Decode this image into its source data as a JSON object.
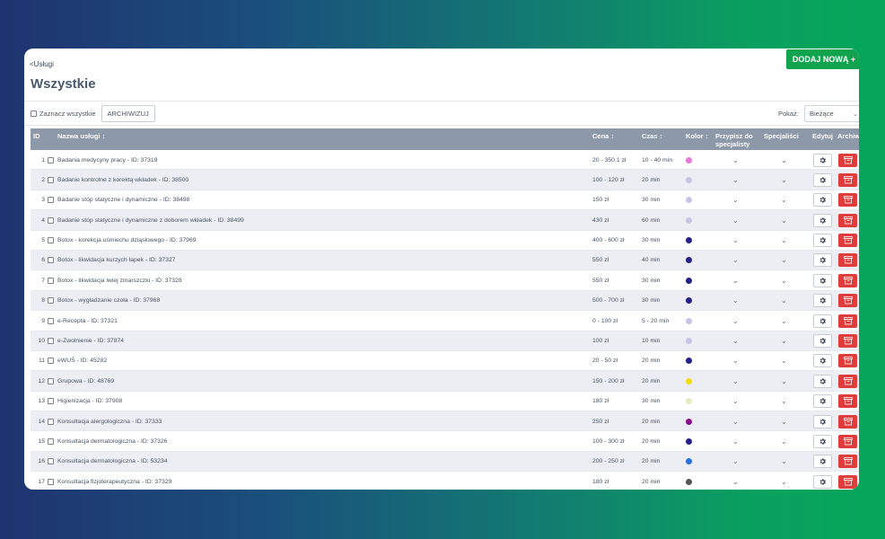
{
  "nav": {
    "back_label": "<Usługi"
  },
  "page": {
    "title": "Wszystkie",
    "add_label": "DODAJ NOWĄ +"
  },
  "toolbar": {
    "select_all_label": "Zaznacz wszystkie",
    "archive_label": "ARCHIWIZUJ",
    "show_label": "Pokaż:",
    "show_value": "Bieżące"
  },
  "columns": {
    "id": "ID",
    "name": "Nazwa usługi",
    "price": "Cena",
    "time": "Czas",
    "color": "Kolor",
    "assign_line1": "Przypisz do",
    "assign_line2": "specjalisty",
    "specialists": "Specjaliści",
    "edit": "Edytuj",
    "archive": "Archiwi"
  },
  "icons": {
    "sort": "sort-icon",
    "chevron": "chevron-down-icon",
    "gear": "gear-icon",
    "archive": "archive-box-icon"
  },
  "rows": [
    {
      "id": "1",
      "name": "Badania medycyny pracy - ID: 37319",
      "price": "20 - 350.1 zł",
      "time": "10 - 40 min",
      "color": "#e879d6"
    },
    {
      "id": "2",
      "name": "Badanie kontrolne z korektą wkładek - ID: 38500",
      "price": "100 - 120 zł",
      "time": "20 min",
      "color": "#c7c4e6"
    },
    {
      "id": "3",
      "name": "Badanie stóp statyczne i dynamiczne - ID: 38498",
      "price": "150 zł",
      "time": "30 min",
      "color": "#c7c4e6"
    },
    {
      "id": "4",
      "name": "Badanie stóp statyczne i dynamiczne z doborem wkładek - ID: 38499",
      "price": "430 zł",
      "time": "60 min",
      "color": "#c7c4e6"
    },
    {
      "id": "5",
      "name": "Botox - korekcja uśmiechu dziąsłowego - ID: 37969",
      "price": "400 - 600 zł",
      "time": "30 min",
      "color": "#26208a"
    },
    {
      "id": "6",
      "name": "Botox - likwidacja kurzych łapek - ID: 37327",
      "price": "550 zł",
      "time": "40 min",
      "color": "#26208a"
    },
    {
      "id": "7",
      "name": "Botox - likwidacja lwiej zmarszczki - ID: 37328",
      "price": "550 zł",
      "time": "30 min",
      "color": "#26208a"
    },
    {
      "id": "8",
      "name": "Botox - wygładzanie czoła - ID: 37968",
      "price": "500 - 700 zł",
      "time": "30 min",
      "color": "#26208a"
    },
    {
      "id": "9",
      "name": "e-Recepta - ID: 37321",
      "price": "0 - 100 zł",
      "time": "5 - 20 min",
      "color": "#c7c4e6"
    },
    {
      "id": "10",
      "name": "e-Zwolnienie - ID: 37874",
      "price": "100 zł",
      "time": "10 min",
      "color": "#c7c4e6"
    },
    {
      "id": "11",
      "name": "eWUŚ - ID: 45282",
      "price": "20 - 50 zł",
      "time": "20 min",
      "color": "#26208a"
    },
    {
      "id": "12",
      "name": "Grupowa - ID: 48769",
      "price": "150 - 200 zł",
      "time": "20 min",
      "color": "#f2dc14"
    },
    {
      "id": "13",
      "name": "Higienizacja - ID: 37908",
      "price": "180 zł",
      "time": "30 min",
      "color": "#e7ecc0"
    },
    {
      "id": "14",
      "name": "Konsultacja alergologiczna - ID: 37333",
      "price": "250 zł",
      "time": "20 min",
      "color": "#8a0f8a"
    },
    {
      "id": "15",
      "name": "Konsultacja dermatologiczna - ID: 37326",
      "price": "100 - 300 zł",
      "time": "20 min",
      "color": "#26208a"
    },
    {
      "id": "16",
      "name": "Konsultacja dermatologiczna - ID: 53234",
      "price": "200 - 250 zł",
      "time": "20 min",
      "color": "#2a6fe0"
    },
    {
      "id": "17",
      "name": "Konsultacja fizjoterapeutyczna - ID: 37329",
      "price": "180 zł",
      "time": "20 min",
      "color": "#555555"
    }
  ]
}
